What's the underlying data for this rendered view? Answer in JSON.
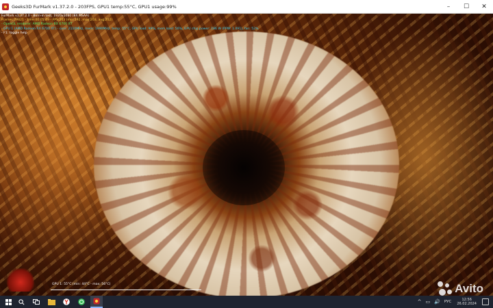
{
  "window": {
    "title": "Geeks3D FurMark v1.37.2.0 - 203FPS, GPU1 temp:55°C, GPU1 usage:99%",
    "controls": {
      "minimize": "–",
      "maximize": "☐",
      "close": "✕"
    }
  },
  "osd": {
    "line1": "FurMark v1.37.2.0 - Burn-in test, 1920x1080 (8X MSAA)",
    "line2": "Frames:79821 - time:00:05:49 - FPS:203 (min:192, max:203, avg:202)",
    "line3": "- OpenGL renderer: AMD Radeon RX 6700 XT",
    "line4": "- GPU 1 (AMD Radeon RX 6700 XT) - core: 2110MHz, mem: 1990MHz, temp: 55°C, GPU load: 99%, mem load: 56%, GPU chip power: 186 W (PPW: 1.091), fan: 52%",
    "line5": "- F1: toggle help"
  },
  "temp_graph": {
    "label": "GPU 1: 55°C (min: 44°C - max: 56°C)"
  },
  "watermark": {
    "text": "Avito"
  },
  "taskbar": {
    "icons": [
      "windows-start-icon",
      "search-icon",
      "task-view-icon",
      "file-explorer-icon",
      "yandex-browser-icon",
      "whatsapp-icon",
      "furmark-icon"
    ],
    "tray": {
      "chevron": "^",
      "network": "▭",
      "volume": "🔊",
      "language": "РУС",
      "time": "12:56",
      "date": "26.02.2024"
    }
  },
  "colors": {
    "osd_yellow": "#ffd84a",
    "osd_green": "#4fe36a",
    "osd_cyan": "#39c9e8",
    "taskbar": "#1f2430"
  }
}
